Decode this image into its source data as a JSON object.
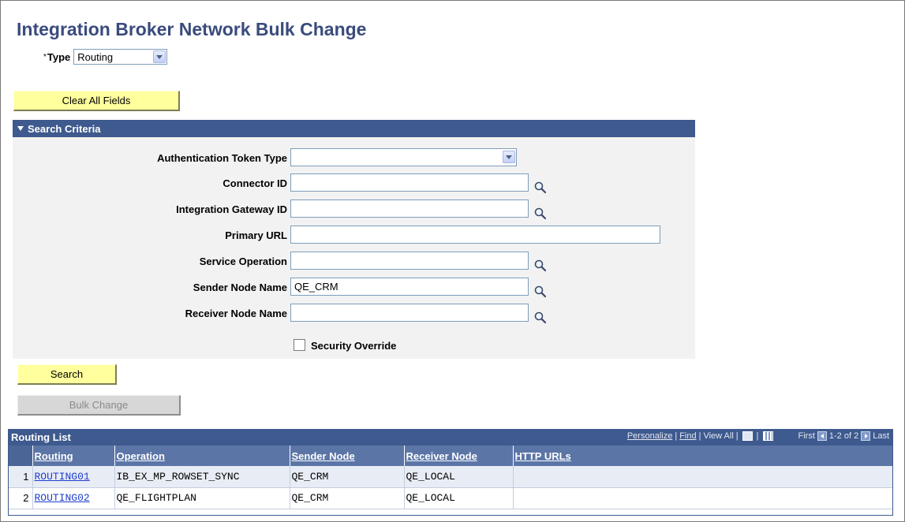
{
  "page": {
    "title": "Integration Broker Network Bulk Change"
  },
  "type_field": {
    "required_marker": "*",
    "label": "Type",
    "value": "Routing"
  },
  "buttons": {
    "clear_all": "Clear All Fields",
    "search": "Search",
    "bulk_change": "Bulk Change"
  },
  "search_criteria": {
    "header": "Search Criteria",
    "fields": {
      "auth_token_type": {
        "label": "Authentication Token Type",
        "value": ""
      },
      "connector_id": {
        "label": "Connector ID",
        "value": ""
      },
      "gateway_id": {
        "label": "Integration Gateway ID",
        "value": ""
      },
      "primary_url": {
        "label": "Primary URL",
        "value": ""
      },
      "service_operation": {
        "label": "Service Operation",
        "value": ""
      },
      "sender_node": {
        "label": "Sender Node Name",
        "value": "QE_CRM"
      },
      "receiver_node": {
        "label": "Receiver Node Name",
        "value": ""
      }
    },
    "security_override": {
      "label": "Security Override",
      "checked": false
    }
  },
  "routing_list": {
    "title": "Routing List",
    "nav": {
      "personalize": "Personalize",
      "find": "Find",
      "view_all": "View All",
      "first": "First",
      "range": "1-2 of 2",
      "last": "Last"
    },
    "columns": [
      "Routing",
      "Operation",
      "Sender Node",
      "Receiver Node",
      "HTTP URLs"
    ],
    "rows": [
      {
        "num": "1",
        "routing": "ROUTING01",
        "operation": "IB_EX_MP_ROWSET_SYNC",
        "sender": "QE_CRM",
        "receiver": "QE_LOCAL",
        "http": ""
      },
      {
        "num": "2",
        "routing": "ROUTING02",
        "operation": "QE_FLIGHTPLAN",
        "sender": "QE_CRM",
        "receiver": "QE_LOCAL",
        "http": ""
      }
    ]
  },
  "colors": {
    "title": "#3a4b7d",
    "header_bar": "#3e5a8e",
    "button_yellow": "#ffff9d",
    "link": "#1f3ecf"
  }
}
